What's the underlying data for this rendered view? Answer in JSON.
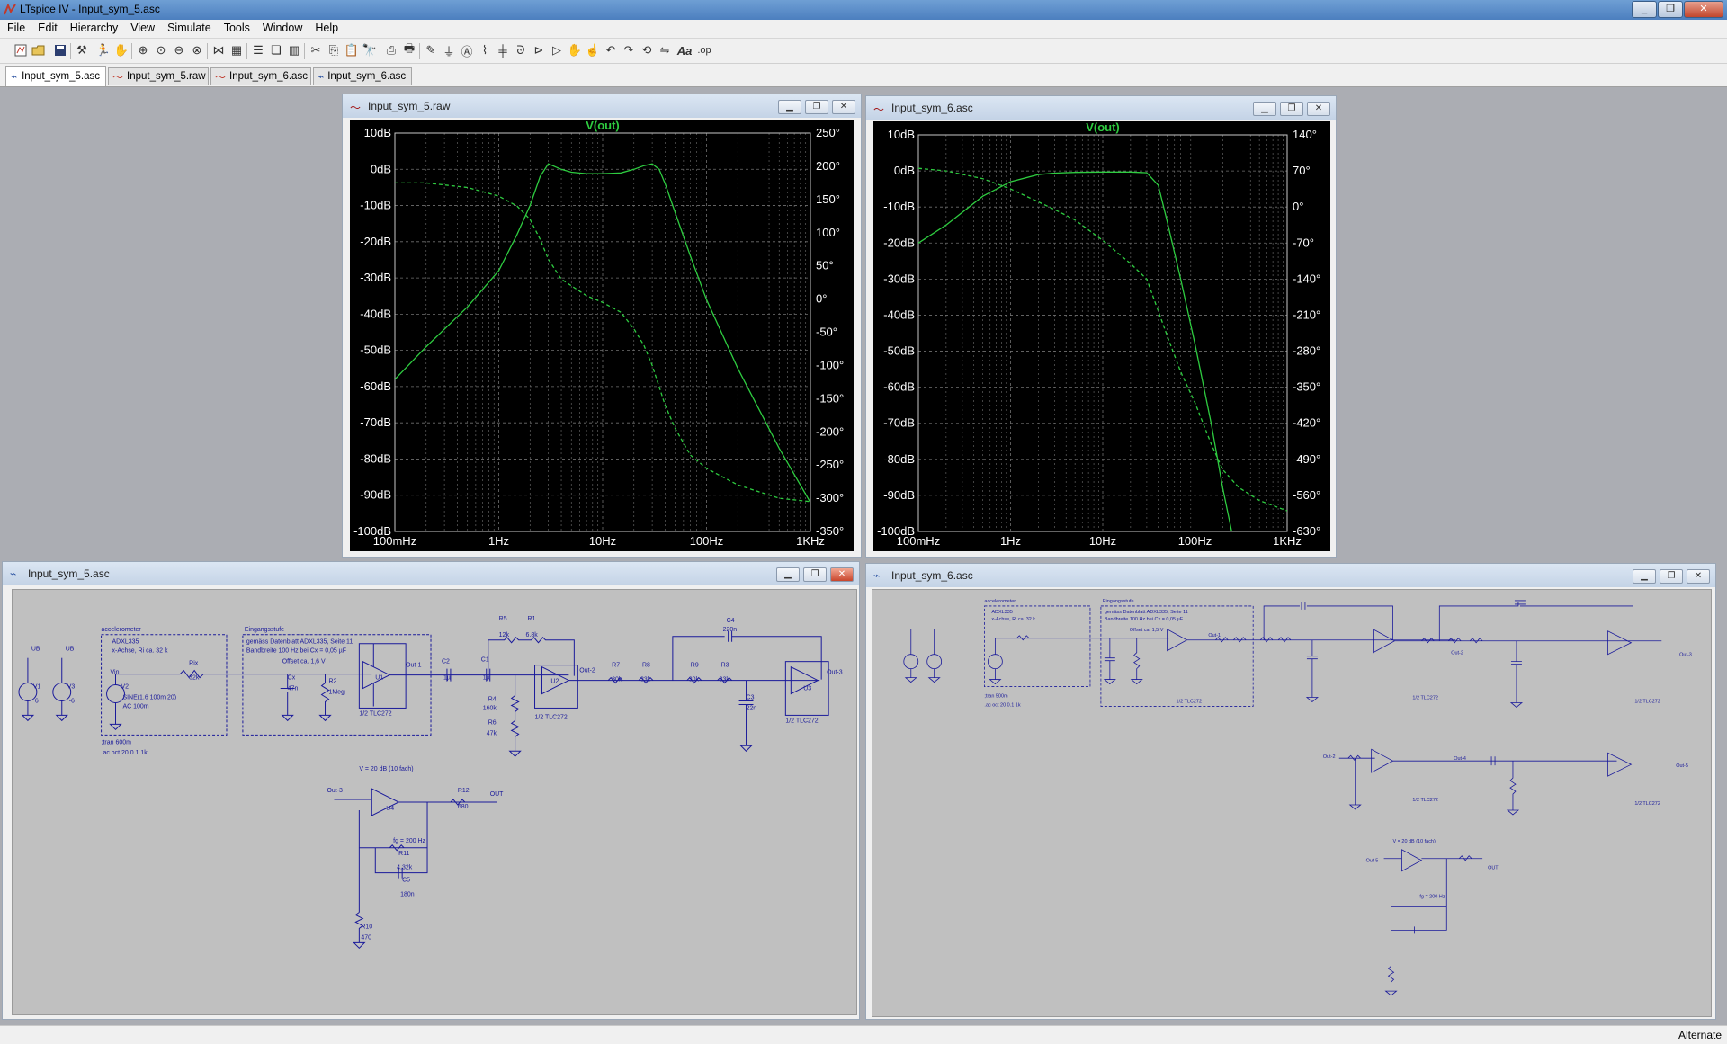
{
  "app": {
    "title": "LTspice IV - Input_sym_5.asc"
  },
  "menu": [
    "File",
    "Edit",
    "Hierarchy",
    "View",
    "Simulate",
    "Tools",
    "Window",
    "Help"
  ],
  "toolbar": {
    "icons": [
      "new-schematic-icon",
      "open-icon",
      "save-icon",
      "control-panel-icon",
      "run-icon",
      "halt-icon",
      "zoom-in-icon",
      "zoom-pan-icon",
      "zoom-out-icon",
      "zoom-fit-icon",
      "autorange-icon",
      "grid-icon",
      "tile-horizontal-icon",
      "cascade-icon",
      "tile-vertical-icon",
      "cut-icon",
      "copy-icon",
      "paste-icon",
      "find-icon",
      "print-setup-icon",
      "print-icon",
      "draw-wire-icon",
      "ground-icon",
      "label-icon",
      "resistor-icon",
      "capacitor-icon",
      "inductor-icon",
      "diode-icon",
      "component-icon",
      "move-icon",
      "drag-icon",
      "undo-icon",
      "redo-icon",
      "rotate-icon",
      "mirror-icon",
      "text-icon",
      "spice-directive-icon"
    ],
    "text_icons": {
      "text": "Aa",
      "spice": ".op"
    }
  },
  "tabs": [
    {
      "label": "Input_sym_5.asc",
      "kind": "schematic",
      "active": true
    },
    {
      "label": "Input_sym_5.raw",
      "kind": "waveform",
      "active": false
    },
    {
      "label": "Input_sym_6.asc",
      "kind": "waveform",
      "active": false
    },
    {
      "label": "Input_sym_6.asc",
      "kind": "schematic",
      "active": false
    }
  ],
  "windows": {
    "plot1": {
      "title": "Input_sym_5.raw"
    },
    "plot2": {
      "title": "Input_sym_6.asc"
    },
    "schem1": {
      "title": "Input_sym_5.asc"
    },
    "schem2": {
      "title": "Input_sym_6.asc"
    }
  },
  "chart_data": [
    {
      "type": "line",
      "title": "V(out)",
      "x_scale": "log",
      "xlim": [
        0.1,
        1000
      ],
      "x_ticks": [
        "100mHz",
        "1Hz",
        "10Hz",
        "100Hz",
        "1KHz"
      ],
      "ylim": [
        -100,
        10
      ],
      "y_ticks": [
        "10dB",
        "0dB",
        "-10dB",
        "-20dB",
        "-30dB",
        "-40dB",
        "-50dB",
        "-60dB",
        "-70dB",
        "-80dB",
        "-90dB",
        "-100dB"
      ],
      "y2lim": [
        -350,
        250
      ],
      "y2_ticks": [
        "250°",
        "200°",
        "150°",
        "100°",
        "50°",
        "0°",
        "-50°",
        "-100°",
        "-150°",
        "-200°",
        "-250°",
        "-300°",
        "-350°"
      ],
      "grid": true,
      "colors": {
        "trace": "#2ecc40",
        "grid": "#707070",
        "title": "#2ecc40",
        "axis_text": "#ffffff"
      },
      "series": [
        {
          "name": "V(out)",
          "style": "solid",
          "axis": "left",
          "x": [
            0.1,
            0.2,
            0.5,
            1,
            1.5,
            2,
            2.5,
            3,
            4,
            5,
            7,
            10,
            15,
            20,
            25,
            30,
            35,
            40,
            50,
            70,
            100,
            200,
            500,
            1000
          ],
          "y": [
            -58,
            -49,
            -38,
            -28,
            -18,
            -10,
            -2,
            1.5,
            0,
            -0.8,
            -1.2,
            -1.2,
            -1,
            0,
            1,
            1.5,
            0,
            -4,
            -12,
            -24,
            -36,
            -55,
            -77,
            -92
          ]
        },
        {
          "name": "phase",
          "style": "dashed",
          "axis": "right",
          "x": [
            0.1,
            0.2,
            0.5,
            1,
            1.5,
            2,
            2.5,
            3,
            4,
            5,
            7,
            10,
            15,
            20,
            25,
            30,
            40,
            50,
            70,
            100,
            200,
            500,
            1000
          ],
          "y": [
            175,
            175,
            168,
            155,
            140,
            120,
            90,
            60,
            30,
            20,
            5,
            -5,
            -20,
            -45,
            -70,
            -100,
            -160,
            -195,
            -235,
            -255,
            -280,
            -300,
            -305
          ]
        }
      ]
    },
    {
      "type": "line",
      "title": "V(out)",
      "x_scale": "log",
      "xlim": [
        0.1,
        1000
      ],
      "x_ticks": [
        "100mHz",
        "1Hz",
        "10Hz",
        "100Hz",
        "1KHz"
      ],
      "ylim": [
        -100,
        10
      ],
      "y_ticks": [
        "10dB",
        "0dB",
        "-10dB",
        "-20dB",
        "-30dB",
        "-40dB",
        "-50dB",
        "-60dB",
        "-70dB",
        "-80dB",
        "-90dB",
        "-100dB"
      ],
      "y2lim": [
        -630,
        140
      ],
      "y2_ticks": [
        "140°",
        "70°",
        "0°",
        "-70°",
        "-140°",
        "-210°",
        "-280°",
        "-350°",
        "-420°",
        "-490°",
        "-560°",
        "-630°"
      ],
      "grid": true,
      "colors": {
        "trace": "#2ecc40",
        "grid": "#707070",
        "title": "#2ecc40",
        "axis_text": "#ffffff"
      },
      "series": [
        {
          "name": "V(out)",
          "style": "solid",
          "axis": "left",
          "x": [
            0.1,
            0.2,
            0.5,
            1,
            2,
            3,
            5,
            10,
            20,
            30,
            40,
            50,
            70,
            100,
            150,
            200,
            250
          ],
          "y": [
            -20,
            -15,
            -7,
            -3,
            -1,
            -0.6,
            -0.4,
            -0.3,
            -0.3,
            -0.5,
            -4,
            -14,
            -30,
            -48,
            -70,
            -88,
            -100
          ]
        },
        {
          "name": "phase",
          "style": "dashed",
          "axis": "right",
          "x": [
            0.1,
            0.2,
            0.5,
            1,
            2,
            3,
            5,
            10,
            20,
            30,
            50,
            70,
            100,
            150,
            200,
            300,
            500,
            1000
          ],
          "y": [
            75,
            70,
            55,
            35,
            10,
            -5,
            -25,
            -65,
            -110,
            -140,
            -250,
            -320,
            -380,
            -460,
            -510,
            -545,
            -570,
            -590
          ]
        }
      ]
    }
  ],
  "schem1_text": {
    "acc": "accelerometer",
    "adxl": "ADXL335",
    "xachse": "x-Achse, Ri ca. 32 k",
    "stufe": "Eingangsstufe",
    "ds1": "gemäss Datenblatt ADXL335, Seite 11",
    "ds2": "Bandbreite 100 Hz bei Cx = 0,05 µF",
    "offset": "Offset ca. 1,6 V",
    "vin": "Vin",
    "v1": "V1",
    "v2": "V2",
    "v3": "V3",
    "v1val": "6",
    "v3val": "-6",
    "ub": "UB",
    "sine": "SINE(1.6 100m 20)",
    "ac": "AC 100m",
    "ri": "Rix",
    "rival": "32k",
    "cx": "Cx",
    "cxval": "47n",
    "r2": "R2",
    "r2val": "1Meg",
    "u1": "U1",
    "u2": "U2",
    "u3": "U3",
    "u4": "U4",
    "tlc": "1/2 TLC272",
    "out1": "Out-1",
    "out2": "Out-2",
    "out3": "Out-3",
    "c2": "C2",
    "c2val": "1µ",
    "c1": "C1",
    "c1val": "1µ",
    "r5": "R5",
    "r5val": "12k",
    "r1": "R1",
    "r1val": "6.8k",
    "r4": "R4",
    "r4val": "160k",
    "r6": "R6",
    "r6val": "47k",
    "r7": "R7",
    "r7val": "30k",
    "r8": "R8",
    "r8val": "33k",
    "r9": "R9",
    "r9val": "30k",
    "r3": "R3",
    "r3val": "33k",
    "c4": "C4",
    "c4val": "220n",
    "c3": "C3",
    "c3val": "22n",
    "tran": ";tran 600m",
    "acd": ".ac oct 20 0.1 1k",
    "gain": "V = 20 dB (10 fach)",
    "fg": "fg = 200 Hz",
    "r11": "R11",
    "r11val": "4.32k",
    "c5": "C5",
    "c5val": "180n",
    "r12": "R12",
    "r12val": "680",
    "r10": "R10",
    "r10val": "470",
    "outl": "OUT"
  },
  "schem2_text": {
    "acc": "accelerometer",
    "adxl": "ADXL335",
    "xachse": "x-Achse, Ri ca. 32 k",
    "stufe": "Eingangsstufe",
    "ds1": "gemäss Datenblatt ADXL335, Seite 11",
    "ds2": "Bandbreite 100 Hz bei Cx = 0,05 µF",
    "offset": "Offset ca. 1,5 V",
    "tran": ";tran 500m",
    "acd": ".ac oct 20 0.1 1k",
    "tlc": "1/2 TLC272",
    "gain": "V = 20 dB (10 fach)",
    "fg": "fg = 200 Hz",
    "out1": "Out-1",
    "out2": "Out-2",
    "out3": "Out-3",
    "out4": "Out-4",
    "out5": "Out-5",
    "outl": "OUT"
  },
  "status": {
    "right": "Alternate"
  }
}
